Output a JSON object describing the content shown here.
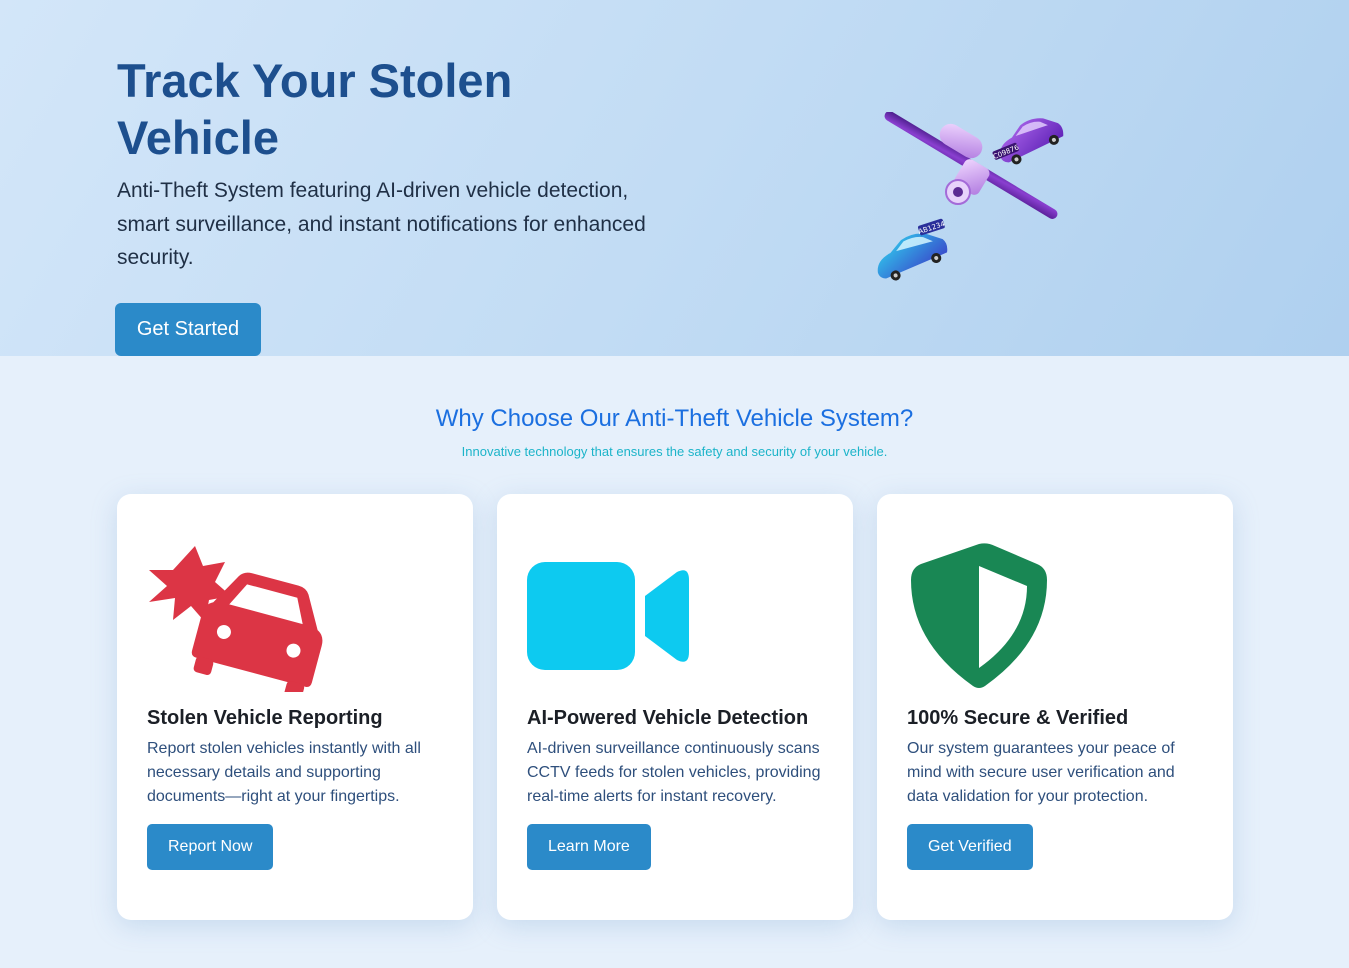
{
  "hero": {
    "title": "Track Your Stolen Vehicle",
    "description": "Anti-Theft System featuring AI-driven vehicle detection, smart surveillance, and instant notifications for enhanced security.",
    "cta_label": "Get Started",
    "illustration": {
      "icon": "surveillance-camera-with-cars-illustration",
      "plate_top": "C09876",
      "plate_bottom": "AB1234"
    }
  },
  "features": {
    "title": "Why Choose Our Anti-Theft Vehicle System?",
    "subtitle": "Innovative technology that ensures the safety and security of your vehicle.",
    "cards": [
      {
        "icon": "car-crash-icon",
        "icon_color": "#dc3545",
        "title": "Stolen Vehicle Reporting",
        "text": "Report stolen vehicles instantly with all necessary details and supporting documents—right at your fingertips.",
        "button": "Report Now"
      },
      {
        "icon": "video-camera-icon",
        "icon_color": "#0dcaf0",
        "title": "AI-Powered Vehicle Detection",
        "text": "AI-driven surveillance continuously scans CCTV feeds for stolen vehicles, providing real-time alerts for instant recovery.",
        "button": "Learn More"
      },
      {
        "icon": "shield-half-icon",
        "icon_color": "#198754",
        "title": "100% Secure & Verified",
        "text": "Our system guarantees your peace of mind with secure user verification and data validation for your protection.",
        "button": "Get Verified"
      }
    ]
  },
  "colors": {
    "primary_button": "#2b8ac9",
    "heading_dark": "#1d4f8e",
    "section_title": "#1b6fe0",
    "section_subtitle": "#1cb4c9"
  }
}
